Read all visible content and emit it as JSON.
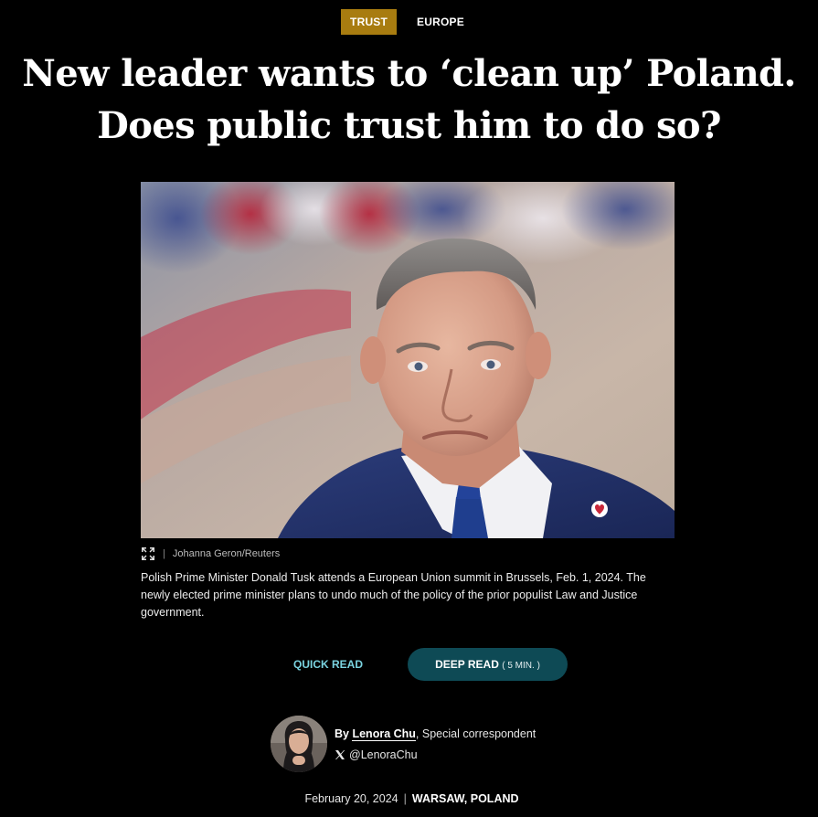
{
  "tags": {
    "primary": "TRUST",
    "secondary": "EUROPE"
  },
  "headline": {
    "line1": "New leader wants to ‘clean up’ Poland.",
    "line2": "Does public trust him to do so?"
  },
  "photo": {
    "credit_separator": "|",
    "credit": "Johanna Geron/Reuters",
    "caption": "Polish Prime Minister Donald Tusk attends a European Union summit in Brussels, Feb. 1, 2024. The newly elected prime minister plans to undo much of the policy of the prior populist Law and Justice government.",
    "expand_icon": "expand-icon"
  },
  "read_toggle": {
    "quick_label": "QUICK READ",
    "deep_label": "DEEP READ",
    "deep_meta": "( 5 MIN. )"
  },
  "byline": {
    "prefix": "By",
    "author": "Lenora Chu",
    "role": ", Special correspondent",
    "social_icon": "x-icon",
    "handle": "@LenoraChu"
  },
  "dateline": {
    "date": "February 20, 2024",
    "separator": "|",
    "location": "WARSAW, POLAND"
  },
  "colors": {
    "background": "#000000",
    "tag_primary_bg": "#a87c10",
    "quick_read": "#7ad3e0",
    "deep_read_bg": "#0e4a55"
  }
}
